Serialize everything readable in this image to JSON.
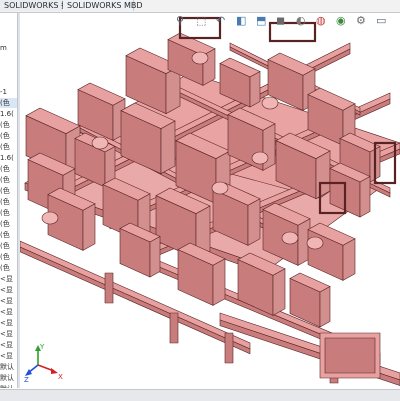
{
  "tabs": [
    {
      "label": "SOLIDWORKS 插件"
    },
    {
      "label": "SOLIDWORKS MBD"
    }
  ],
  "tree": {
    "rows": [
      {
        "text": "m"
      },
      {
        "text": ""
      },
      {
        "text": ""
      },
      {
        "text": ""
      },
      {
        "text": "-1"
      },
      {
        "text": "(色"
      },
      {
        "text": "1.6("
      },
      {
        "text": "(色"
      },
      {
        "text": "(色"
      },
      {
        "text": "(色"
      },
      {
        "text": "1.6("
      },
      {
        "text": "(色"
      },
      {
        "text": "(色"
      },
      {
        "text": "(色"
      },
      {
        "text": "(色"
      },
      {
        "text": "(色"
      },
      {
        "text": "(色"
      },
      {
        "text": "(色"
      },
      {
        "text": "(色"
      },
      {
        "text": "(色"
      },
      {
        "text": "(色"
      },
      {
        "text": "<显"
      },
      {
        "text": "<显"
      },
      {
        "text": "<显"
      },
      {
        "text": "<显"
      },
      {
        "text": "<显"
      },
      {
        "text": "<显"
      },
      {
        "text": "<显"
      },
      {
        "text": "<显"
      },
      {
        "text": "默认"
      },
      {
        "text": "默认"
      },
      {
        "text": "默认"
      }
    ]
  },
  "colors": {
    "model_fill": "#e8a1a1",
    "model_stroke": "#5a2323",
    "model_shadow": "#c87c7c",
    "triad_x": "#d42020",
    "triad_y": "#2ca02c",
    "triad_z": "#1f4fd6"
  },
  "triad": {
    "x": "X",
    "y": "Y",
    "z": "Z"
  },
  "hud_icons": [
    "search-icon",
    "zoom-area-icon",
    "previous-view-icon",
    "section-view-icon",
    "view-orientation-icon",
    "display-style-icon",
    "hide-show-icon",
    "edit-appearance-icon",
    "scene-icon",
    "view-settings-icon",
    "monitor-icon"
  ]
}
